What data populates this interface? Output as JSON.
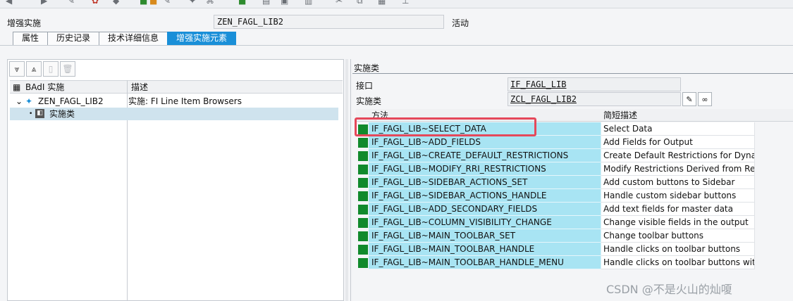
{
  "header": {
    "label": "增强实施",
    "impl_name": "ZEN_FAGL_LIB2",
    "status": "活动"
  },
  "tabs": [
    {
      "label": "属性",
      "active": false
    },
    {
      "label": "历史记录",
      "active": false
    },
    {
      "label": "技术详细信息",
      "active": false
    },
    {
      "label": "增强实施元素",
      "active": true
    }
  ],
  "tree": {
    "columns": [
      "BAdI 实施",
      "描述"
    ],
    "rows": [
      {
        "name": "ZEN_FAGL_LIB2",
        "desc": "实施:  FI Line Item Browsers"
      },
      {
        "name": "实施类",
        "desc": ""
      }
    ]
  },
  "impl_class_panel": {
    "title": "实施类",
    "interface_label": "接口",
    "interface_value": "IF_FAGL_LIB",
    "class_label": "实施类",
    "class_value": "ZCL_FAGL_LIB2"
  },
  "methods": {
    "columns": [
      "方法",
      "简短描述"
    ],
    "rows": [
      {
        "method": "IF_FAGL_LIB~SELECT_DATA",
        "desc": "Select Data"
      },
      {
        "method": "IF_FAGL_LIB~ADD_FIELDS",
        "desc": "Add Fields for Output"
      },
      {
        "method": "IF_FAGL_LIB~CREATE_DEFAULT_RESTRICTIONS",
        "desc": "Create Default Restrictions for Dynam..."
      },
      {
        "method": "IF_FAGL_LIB~MODIFY_RRI_RESTRICTIONS",
        "desc": "Modify Restrictions Derived from Rep..."
      },
      {
        "method": "IF_FAGL_LIB~SIDEBAR_ACTIONS_SET",
        "desc": "Add custom buttons to Sidebar"
      },
      {
        "method": "IF_FAGL_LIB~SIDEBAR_ACTIONS_HANDLE",
        "desc": "Handle custom sidebar buttons"
      },
      {
        "method": "IF_FAGL_LIB~ADD_SECONDARY_FIELDS",
        "desc": "Add text fields for master data"
      },
      {
        "method": "IF_FAGL_LIB~COLUMN_VISIBILITY_CHANGE",
        "desc": "Change visible fields in the output"
      },
      {
        "method": "IF_FAGL_LIB~MAIN_TOOLBAR_SET",
        "desc": "Change toolbar buttons"
      },
      {
        "method": "IF_FAGL_LIB~MAIN_TOOLBAR_HANDLE",
        "desc": "Handle clicks on toolbar buttons"
      },
      {
        "method": "IF_FAGL_LIB~MAIN_TOOLBAR_HANDLE_MENU",
        "desc": "Handle clicks on toolbar buttons with..."
      }
    ]
  },
  "watermark": "CSDN @不是火山的灿嗄",
  "colors": {
    "active_tab": "#1a8fd8",
    "method_cell": "#a8e4f3",
    "status_icon": "#118a2c",
    "highlight": "#e5485a"
  }
}
